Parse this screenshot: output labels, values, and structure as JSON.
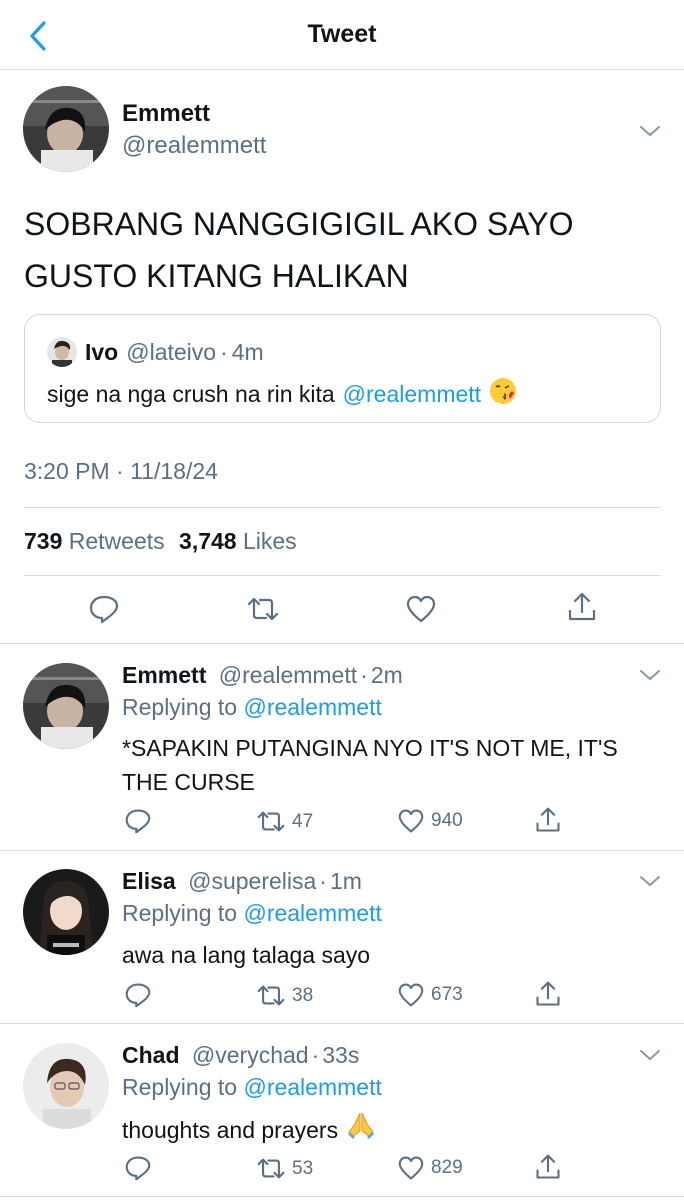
{
  "header": {
    "title": "Tweet",
    "back_icon": "chevron-left-icon"
  },
  "main_tweet": {
    "name": "Emmett",
    "handle": "@realemmett",
    "text_line1": "SOBRANG NANGGIGIGIL AKO SAYO",
    "text_line2": "GUSTO KITANG HALIKAN",
    "quote": {
      "name": "Ivo",
      "handle": "@lateivo",
      "sep": "·",
      "time": "4m",
      "text": "sige na nga crush na rin kita",
      "mention": "@realemmett",
      "emoji": "kissing-face-emoji"
    },
    "timestamp": "3:20 PM · 11/18/24",
    "retweets_count": "739",
    "retweets_label": "Retweets",
    "likes_count": "3,748",
    "likes_label": "Likes"
  },
  "replies": [
    {
      "name": "Emmett",
      "handle": "@realemmett",
      "sep": "·",
      "time": "2m",
      "replying_label": "Replying to",
      "replying_to": "@realemmett",
      "text": "*SAPAKIN PUTANGINA NYO IT'S NOT ME, IT'S THE CURSE",
      "retweets": "47",
      "likes": "940"
    },
    {
      "name": "Elisa",
      "handle": "@superelisa",
      "sep": "·",
      "time": "1m",
      "replying_label": "Replying to",
      "replying_to": "@realemmett",
      "text": "awa na lang talaga sayo",
      "retweets": "38",
      "likes": "673"
    },
    {
      "name": "Chad",
      "handle": "@verychad",
      "sep": "·",
      "time": "33s",
      "replying_label": "Replying to",
      "replying_to": "@realemmett",
      "text": "thoughts and prayers",
      "emoji": "folded-hands-emoji",
      "retweets": "53",
      "likes": "829"
    }
  ],
  "colors": {
    "accent": "#1d9bf0",
    "muted": "#5b7083",
    "border": "#d8dde1"
  }
}
